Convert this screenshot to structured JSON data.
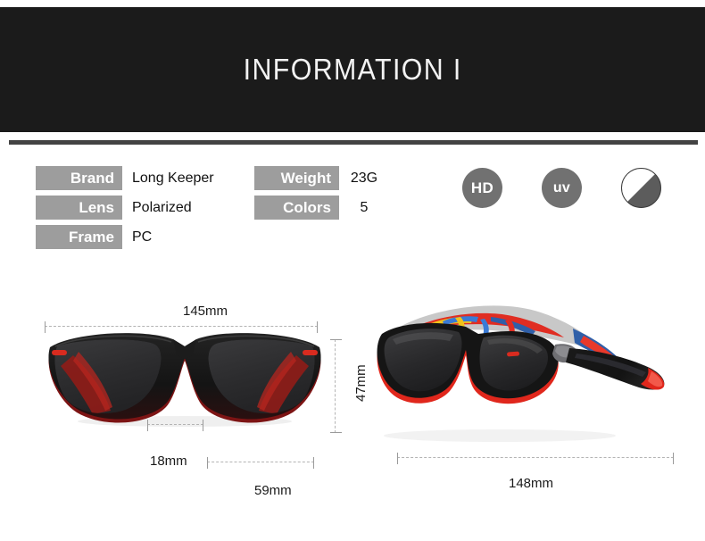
{
  "header": {
    "title": "INFORMATION I"
  },
  "specs": {
    "left_column": [
      {
        "label": "Brand",
        "value": "Long Keeper"
      },
      {
        "label": "Lens",
        "value": "Polarized"
      },
      {
        "label": "Frame",
        "value": "PC"
      }
    ],
    "right_column": [
      {
        "label": "Weight",
        "value": "23G"
      },
      {
        "label": "Colors",
        "value": "5"
      }
    ]
  },
  "badges": [
    {
      "name": "hd-badge",
      "text": "HD"
    },
    {
      "name": "uv-badge",
      "text": "uv"
    },
    {
      "name": "tint-badge",
      "text": ""
    }
  ],
  "dimensions": {
    "front_width": "145mm",
    "front_height": "47mm",
    "bridge_width": "18mm",
    "lens_width": "59mm",
    "side_width": "148mm"
  },
  "colors": {
    "header_background": "#1b1b1b",
    "header_rule": "#434343",
    "chip_gray": "#9d9d9d",
    "badge_gray": "#717171",
    "frame_black": "#141414",
    "accent_red": "#d92b1f",
    "dimension_line": "#b4b4b4"
  }
}
